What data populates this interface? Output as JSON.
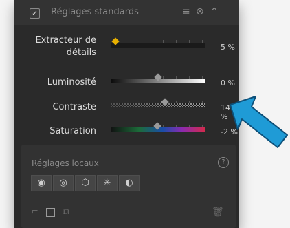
{
  "header": {
    "checkbox_mark": "✓",
    "title": "Réglages standards",
    "icons": [
      "menu-icon",
      "close-icon",
      "collapse-icon"
    ]
  },
  "sliders": [
    {
      "label_line1": "Extracteur de",
      "label_line2": "détails",
      "value": "5 %",
      "level": 0.05,
      "track": "dark",
      "thumb_color": "#e8b000"
    },
    {
      "label": "Luminosité",
      "value": "0 %",
      "level": 0.5,
      "track": "gray-white"
    },
    {
      "label": "Contraste",
      "value": "14 %",
      "level": 0.57,
      "track": "checker"
    },
    {
      "label": "Saturation",
      "value": "-2 %",
      "level": 0.49,
      "track": "rainbow"
    }
  ],
  "local": {
    "title": "Réglages locaux",
    "help": "?",
    "tools": [
      "circle-tool-icon",
      "eye-tool-icon",
      "polygon-tool-icon",
      "burst-tool-icon",
      "color-tool-icon"
    ],
    "bottom_icons": [
      "brush-icon",
      "gradient-icon",
      "copy-icon",
      "trash-icon"
    ]
  },
  "colors": {
    "panel": "#2a2a2a",
    "arrow_fill": "#1f9bd6",
    "arrow_stroke": "#0d4f78"
  }
}
